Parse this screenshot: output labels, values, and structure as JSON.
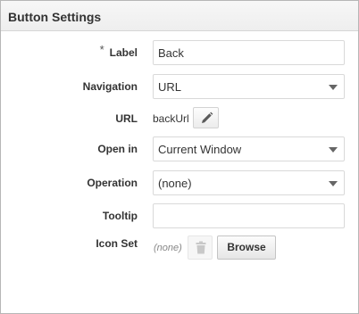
{
  "panel": {
    "title": "Button Settings"
  },
  "form": {
    "label": {
      "required_mark": "*",
      "label": "Label",
      "value": "Back"
    },
    "navigation": {
      "label": "Navigation",
      "value": "URL"
    },
    "url": {
      "label": "URL",
      "value": "backUrl",
      "edit_icon": "pencil-icon"
    },
    "open_in": {
      "label": "Open in",
      "value": "Current Window"
    },
    "operation": {
      "label": "Operation",
      "value": "(none)"
    },
    "tooltip": {
      "label": "Tooltip",
      "value": ""
    },
    "icon_set": {
      "label": "Icon Set",
      "value": "(none)",
      "delete_icon": "trash-icon",
      "browse_label": "Browse"
    }
  },
  "colors": {
    "header_bg": "#eeeeee",
    "border": "#b6b6b6",
    "text": "#333333",
    "muted": "#888888"
  }
}
